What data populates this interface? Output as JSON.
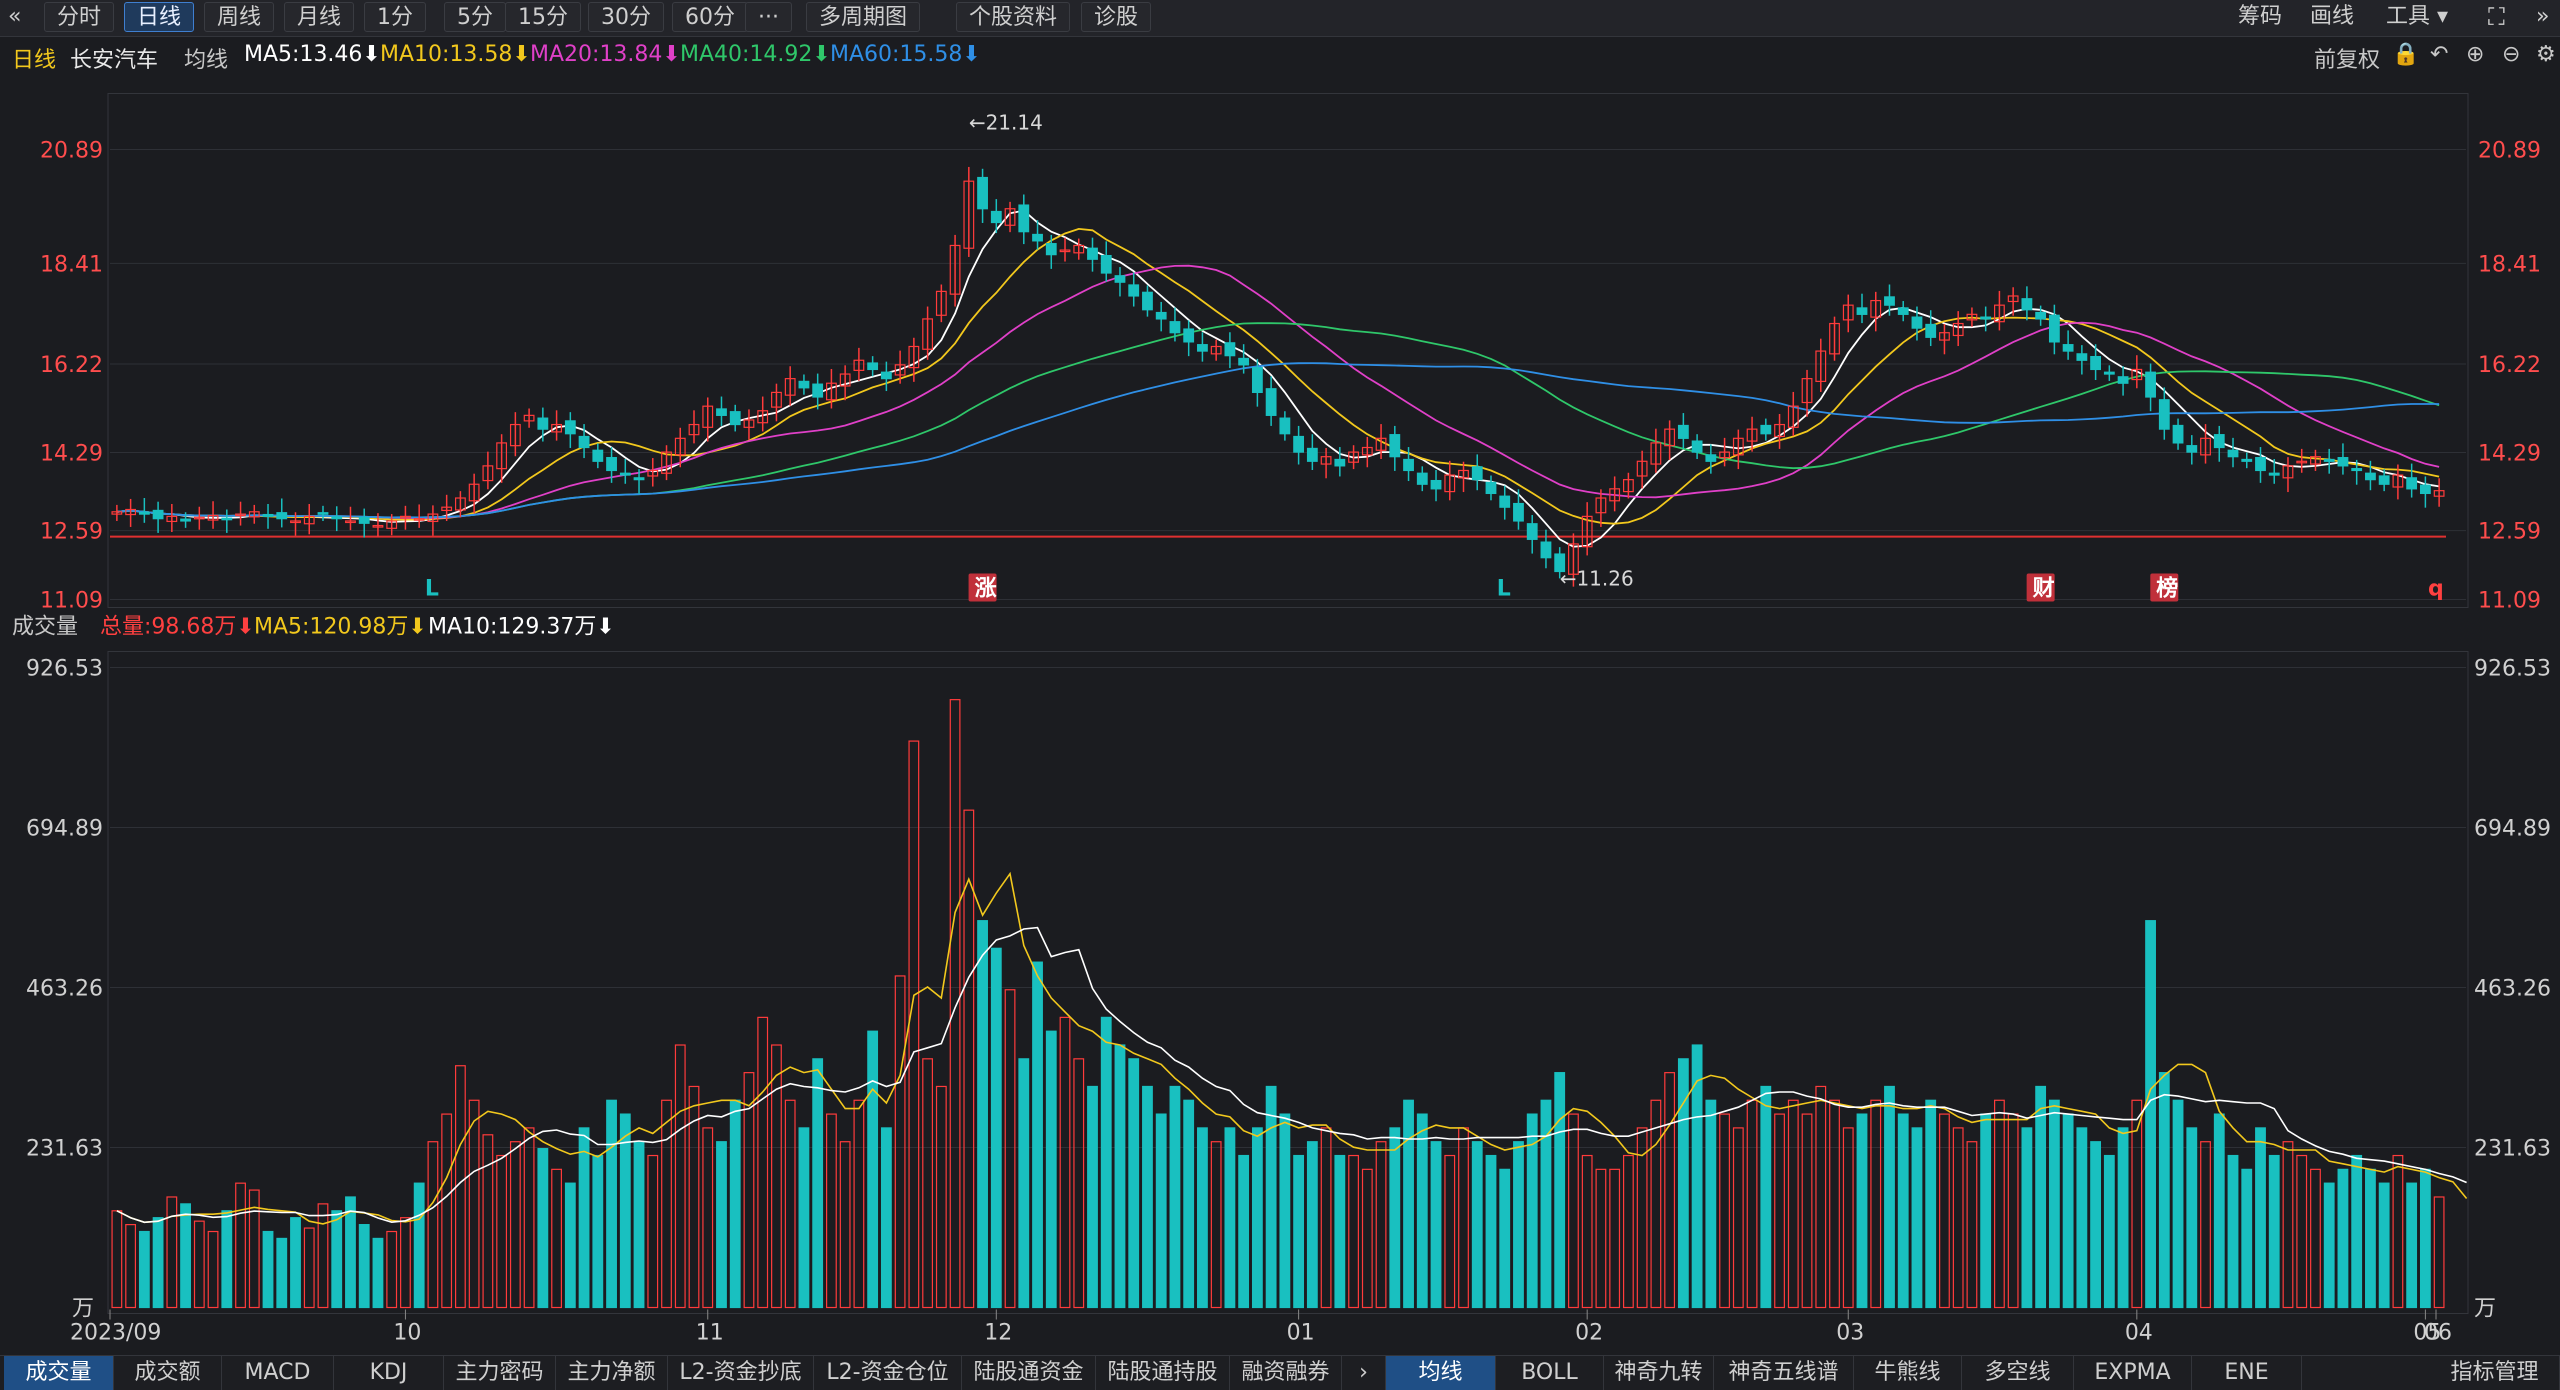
{
  "toolbar": {
    "back_icon": "«",
    "buttons": [
      "分时",
      "日线",
      "周线",
      "月线",
      "1分",
      "5分",
      "15分",
      "30分",
      "60分",
      "···",
      "多周期图",
      "个股资料",
      "诊股"
    ],
    "active": "日线",
    "right": [
      "筹码",
      "画线",
      "工具"
    ],
    "fullscreen_icon": "expand-icon",
    "more_icon": "»"
  },
  "infobar": {
    "period": "日线",
    "stock": "长安汽车",
    "ma_label": "均线",
    "ma": [
      {
        "label": "MA5:13.46",
        "color": "#ffffff"
      },
      {
        "label": "MA10:13.58",
        "color": "#f2c81d"
      },
      {
        "label": "MA20:13.84",
        "color": "#e040c8"
      },
      {
        "label": "MA40:14.92",
        "color": "#2fc76a"
      },
      {
        "label": "MA60:15.58",
        "color": "#2f8fe6"
      }
    ],
    "fq": "前复权"
  },
  "volbar": {
    "title": "成交量",
    "items": [
      {
        "label": "总量:98.68万",
        "color": "#ff4040"
      },
      {
        "label": "MA5:120.98万",
        "color": "#f2c81d"
      },
      {
        "label": "MA10:129.37万",
        "color": "#ffffff"
      }
    ]
  },
  "chart_data": {
    "type": "candlestick",
    "price_axis": {
      "ticks": [
        "20.89",
        "18.41",
        "16.22",
        "14.29",
        "12.59",
        "11.09"
      ],
      "ylim": [
        11.09,
        20.89
      ]
    },
    "volume_axis": {
      "ticks": [
        "926.53",
        "694.89",
        "463.26",
        "231.63",
        "万"
      ],
      "unit": "万",
      "ylim": [
        0,
        926.53
      ]
    },
    "x_labels": [
      "2023/09",
      "10",
      "11",
      "12",
      "01",
      "02",
      "03",
      "04",
      "05",
      "06"
    ],
    "annotations": {
      "high": "←21.14",
      "low": "←11.26"
    },
    "markers": [
      {
        "text": "L",
        "color": "#19c0c0"
      },
      {
        "text": "涨",
        "color": "#ffffff",
        "bg": "#c0303a"
      },
      {
        "text": "L",
        "color": "#19c0c0"
      },
      {
        "text": "财",
        "color": "#ffffff",
        "bg": "#c0303a"
      },
      {
        "text": "榜",
        "color": "#ffffff",
        "bg": "#c0303a"
      },
      {
        "text": "q",
        "color": "#ff4040"
      }
    ],
    "closes": [
      13.0,
      13.05,
      12.95,
      12.85,
      12.9,
      12.8,
      12.88,
      12.92,
      12.85,
      12.95,
      13.0,
      12.9,
      12.85,
      12.8,
      12.9,
      12.95,
      12.85,
      12.8,
      12.75,
      12.7,
      12.8,
      12.9,
      12.85,
      12.95,
      13.1,
      13.3,
      13.6,
      14.0,
      14.5,
      14.9,
      15.1,
      14.8,
      14.9,
      14.7,
      14.4,
      14.1,
      13.9,
      13.8,
      13.7,
      13.9,
      14.3,
      14.6,
      14.9,
      15.3,
      15.1,
      14.9,
      15.0,
      15.2,
      15.6,
      15.9,
      15.7,
      15.5,
      15.8,
      16.0,
      16.3,
      16.1,
      15.9,
      16.2,
      16.6,
      17.2,
      17.8,
      18.8,
      20.2,
      19.6,
      19.3,
      19.6,
      19.1,
      18.9,
      18.6,
      18.7,
      18.8,
      18.5,
      18.2,
      18.0,
      17.7,
      17.4,
      17.2,
      16.9,
      16.7,
      16.5,
      16.6,
      16.4,
      16.2,
      15.6,
      15.1,
      14.7,
      14.3,
      14.1,
      14.2,
      14.0,
      14.3,
      14.4,
      14.6,
      14.2,
      13.9,
      13.6,
      13.5,
      13.8,
      13.9,
      13.7,
      13.4,
      13.1,
      12.8,
      12.4,
      12.0,
      11.7,
      12.3,
      12.9,
      13.3,
      13.5,
      13.7,
      14.1,
      14.5,
      14.8,
      14.6,
      14.3,
      14.1,
      14.3,
      14.6,
      14.8,
      14.7,
      14.9,
      15.3,
      15.9,
      16.5,
      17.1,
      17.5,
      17.3,
      17.6,
      17.5,
      17.3,
      17.0,
      16.8,
      16.9,
      17.1,
      17.3,
      17.2,
      17.5,
      17.7,
      17.4,
      17.2,
      16.7,
      16.5,
      16.3,
      16.1,
      16.0,
      15.8,
      16.1,
      15.5,
      14.8,
      14.5,
      14.3,
      14.6,
      14.4,
      14.2,
      14.1,
      13.9,
      13.8,
      14.0,
      14.1,
      14.2,
      14.1,
      14.0,
      13.9,
      13.7,
      13.6,
      13.8,
      13.5,
      13.4,
      13.46
    ],
    "volumes": [
      140,
      120,
      110,
      130,
      160,
      150,
      125,
      110,
      140,
      180,
      170,
      110,
      100,
      130,
      115,
      150,
      140,
      160,
      120,
      100,
      110,
      130,
      180,
      240,
      280,
      350,
      300,
      250,
      220,
      240,
      260,
      230,
      200,
      180,
      260,
      220,
      300,
      280,
      240,
      220,
      300,
      380,
      320,
      260,
      240,
      300,
      340,
      420,
      380,
      300,
      260,
      360,
      280,
      240,
      300,
      400,
      260,
      480,
      820,
      360,
      320,
      880,
      720,
      560,
      520,
      460,
      360,
      500,
      400,
      420,
      360,
      320,
      420,
      380,
      360,
      320,
      280,
      320,
      300,
      260,
      240,
      260,
      220,
      260,
      320,
      280,
      220,
      240,
      260,
      220,
      220,
      200,
      240,
      260,
      300,
      280,
      240,
      220,
      260,
      240,
      220,
      200,
      240,
      280,
      300,
      340,
      280,
      220,
      200,
      200,
      220,
      260,
      300,
      340,
      360,
      380,
      300,
      280,
      260,
      300,
      320,
      280,
      300,
      280,
      320,
      300,
      260,
      280,
      300,
      320,
      280,
      260,
      300,
      280,
      260,
      240,
      280,
      300,
      280,
      260,
      320,
      300,
      280,
      260,
      240,
      220,
      260,
      300,
      560,
      340,
      300,
      260,
      240,
      280,
      220,
      200,
      260,
      220,
      240,
      220,
      200,
      180,
      200,
      220,
      200,
      180,
      220,
      180,
      200,
      160,
      150,
      99
    ]
  },
  "bottom_tabs": [
    "成交量",
    "成交额",
    "MACD",
    "KDJ",
    "主力密码",
    "主力净额",
    "L2-资金抄底",
    "L2-资金仓位",
    "陆股通资金",
    "陆股通持股",
    "融资融券",
    "›",
    "均线",
    "BOLL",
    "神奇九转",
    "神奇五线谱",
    "牛熊线",
    "多空线",
    "EXPMA",
    "ENE",
    "指标管理"
  ],
  "bottom_active": [
    "成交量",
    "均线"
  ]
}
